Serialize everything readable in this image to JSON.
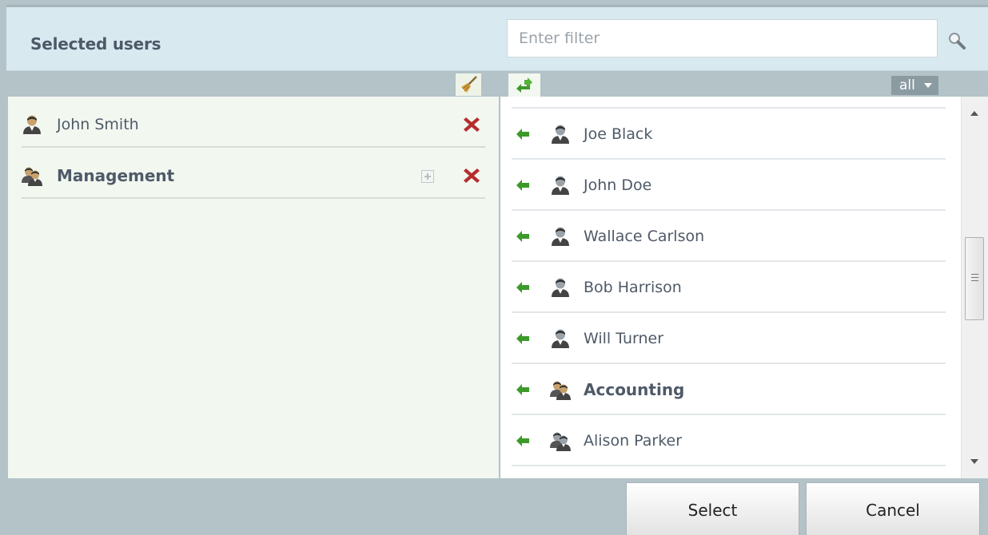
{
  "header": {
    "title": "Selected users",
    "filter_placeholder": "Enter filter",
    "filter_value": ""
  },
  "toolbar": {
    "filter_dropdown": "all"
  },
  "selected": [
    {
      "label": "John Smith",
      "type": "user",
      "bold": false
    },
    {
      "label": "Management",
      "type": "group",
      "bold": true
    }
  ],
  "available": [
    {
      "label": "Joe Black",
      "type": "user",
      "bold": false
    },
    {
      "label": "John Doe",
      "type": "user",
      "bold": false
    },
    {
      "label": "Wallace Carlson",
      "type": "user",
      "bold": false
    },
    {
      "label": "Bob Harrison",
      "type": "user",
      "bold": false
    },
    {
      "label": "Will Turner",
      "type": "user",
      "bold": false
    },
    {
      "label": "Accounting",
      "type": "group",
      "bold": true
    },
    {
      "label": "Alison Parker",
      "type": "group",
      "bold": false
    }
  ],
  "footer": {
    "select_label": "Select",
    "cancel_label": "Cancel"
  },
  "colors": {
    "header_bg": "#d9e9f0",
    "frame_bg": "#b3c3c8",
    "left_panel_bg": "#f2f7f0",
    "remove_red": "#b52d2d",
    "arrow_green": "#3d9a2a",
    "user_icon_colored": "#c8a26a",
    "user_icon_gray": "#9aa3aa"
  },
  "icons": {
    "search": "magnifier-icon",
    "clear_all": "broom-icon",
    "add_all": "swap-arrows-icon",
    "remove": "red-x-icon",
    "add": "green-arrow-left-icon",
    "user": "user-icon",
    "group": "group-icon"
  }
}
